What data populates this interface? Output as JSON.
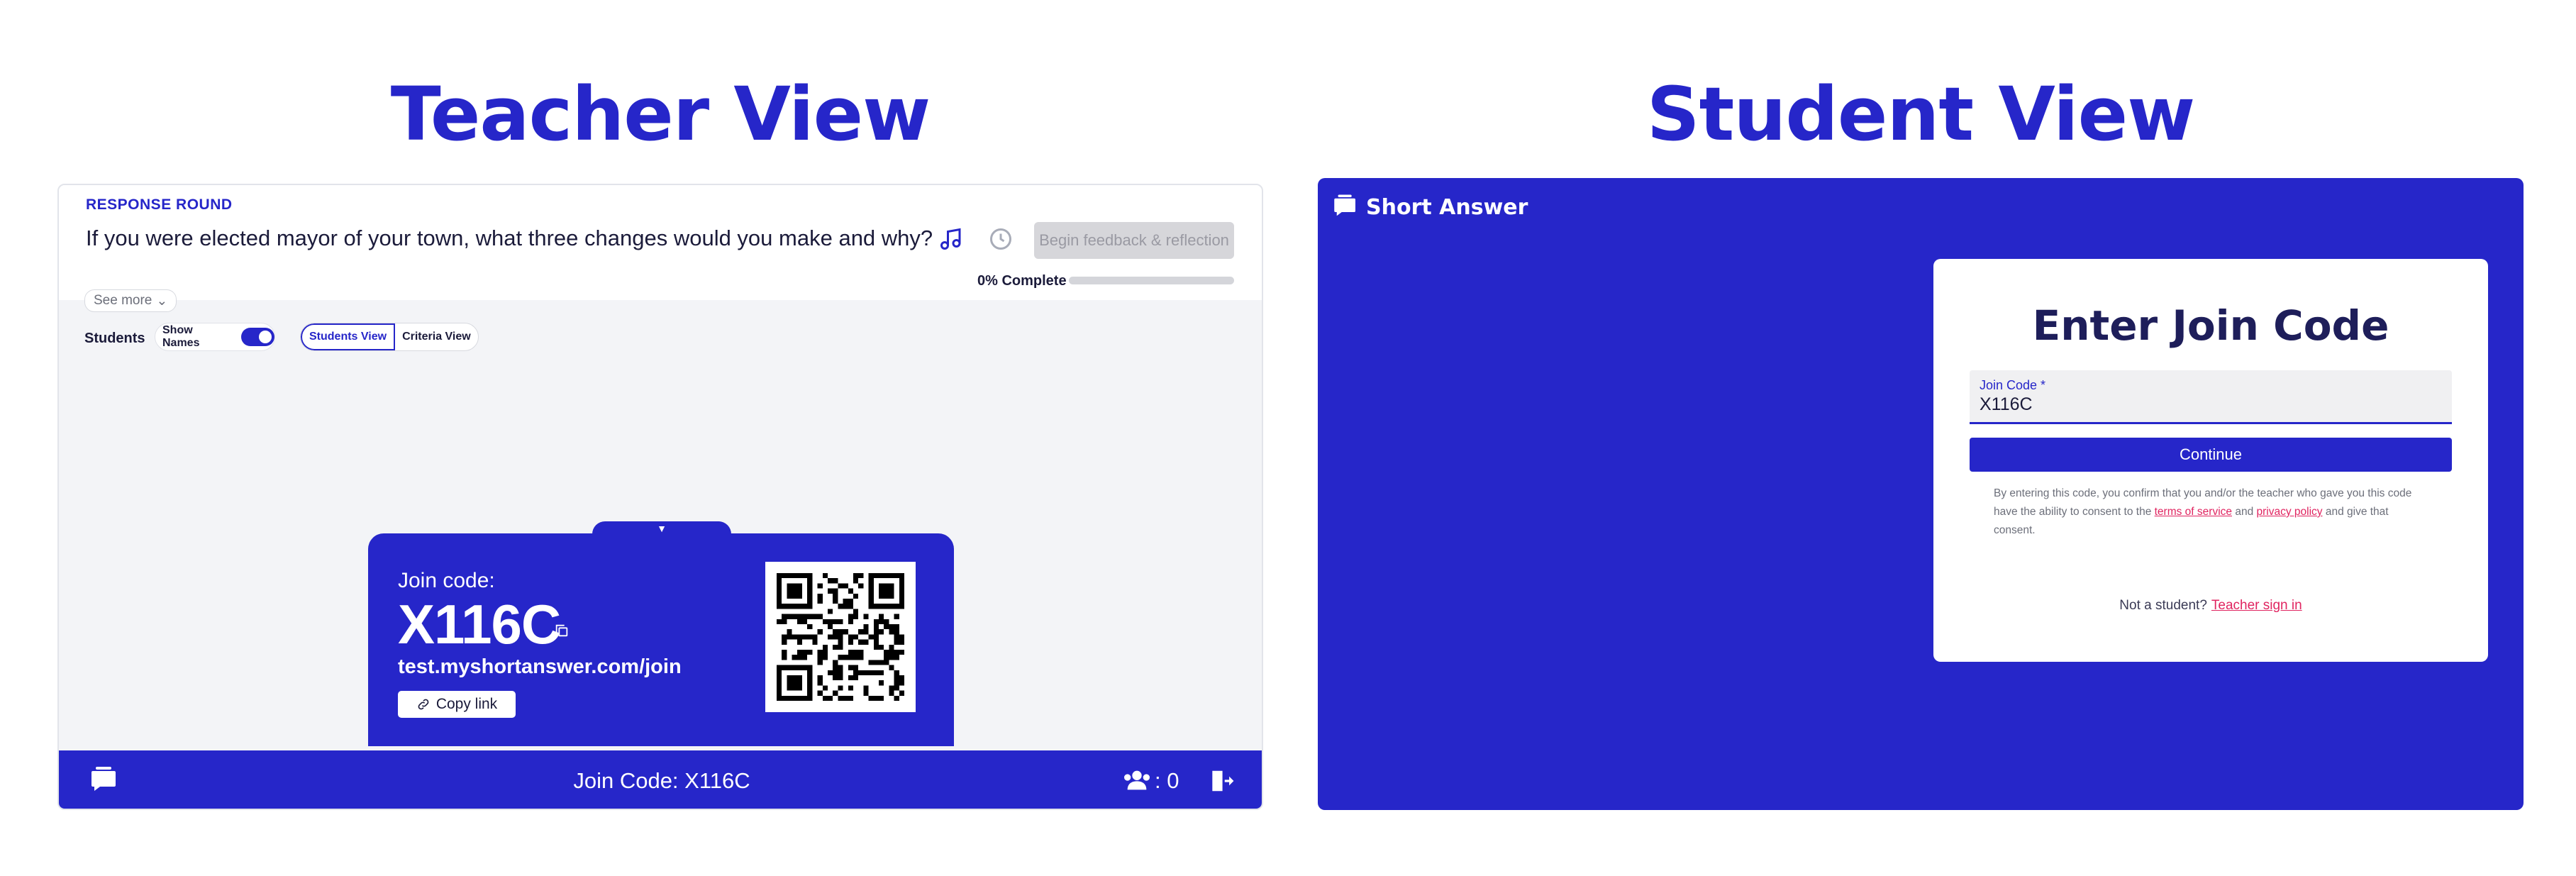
{
  "headings": {
    "teacher": "Teacher View",
    "student": "Student View"
  },
  "teacher": {
    "round_label": "RESPONSE ROUND",
    "question": "If you were elected mayor of your town, what three changes would you make and why?",
    "begin_button": "Begin feedback & reflection",
    "progress_label": "0% Complete",
    "progress": 0,
    "see_more": "See more",
    "students_label": "Students",
    "show_names_label": "Show Names",
    "show_names_on": true,
    "view_tabs": [
      "Students View",
      "Criteria View"
    ],
    "join_card": {
      "label": "Join code:",
      "code": "X116C",
      "url": "test.myshortanswer.com/join",
      "copy_link": "Copy link"
    },
    "footer": {
      "join_code_text": "Join Code: X116C",
      "participants": ": 0"
    }
  },
  "student": {
    "app_name": "Short Answer",
    "form_title": "Enter Join Code",
    "field_label": "Join Code *",
    "field_value": "X116C",
    "continue_button": "Continue",
    "consent_prefix": "By entering this code, you confirm that you and/or the teacher who gave you this code have the ability to consent to the ",
    "terms_link": "terms of service",
    "consent_and": " and ",
    "privacy_link": "privacy policy",
    "consent_suffix": " and give that consent.",
    "not_student": "Not a student?",
    "teacher_signin": "Teacher sign in"
  },
  "icons": {
    "logo": "speech-bubble-icon",
    "music": "music-note-icon",
    "timer": "clock-icon",
    "copy": "copy-icon",
    "link": "link-icon",
    "participants": "people-icon",
    "exit": "exit-icon"
  },
  "colors": {
    "brand": "#2626c9",
    "link": "#e02460",
    "disabled": "#d6d6da"
  }
}
